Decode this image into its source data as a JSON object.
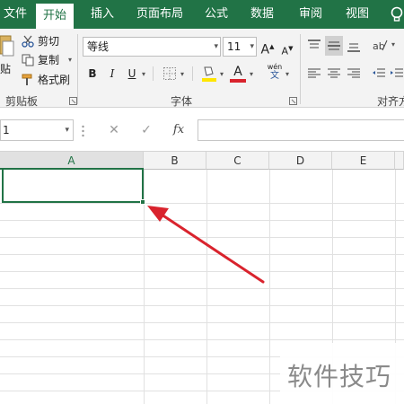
{
  "ribbon_tabs": [
    "文件",
    "开始",
    "插入",
    "页面布局",
    "公式",
    "数据",
    "审阅",
    "视图"
  ],
  "active_tab": "开始",
  "colors": {
    "excel_green": "#217346",
    "font_color_red": "#d9232d",
    "highlight_yellow": "#ffe600",
    "arrow_red": "#d9232d"
  },
  "clipboard": {
    "cut_label": "剪切",
    "copy_label": "复制",
    "format_painter_label": "格式刷",
    "paste_label_partial": "贴",
    "group_label": "剪贴板"
  },
  "font": {
    "font_name": "等线",
    "font_size": "11",
    "grow_font_glyph": "A",
    "shrink_font_glyph": "A",
    "bold_glyph": "B",
    "italic_glyph": "I",
    "underline_glyph": "U",
    "font_color_glyph": "A",
    "phonetic_label": "wén",
    "group_label": "字体"
  },
  "alignment": {
    "group_label_partial": "对齐方"
  },
  "formula_bar": {
    "name_box_value": "1",
    "cancel_glyph": "✕",
    "enter_glyph": "✓",
    "function_glyph": "fx",
    "formula_value": ""
  },
  "grid": {
    "columns": [
      "A",
      "B",
      "C",
      "D",
      "E"
    ],
    "selected_column": "A",
    "active_cell": "A1"
  },
  "annotation": {
    "type": "red-arrow",
    "points_to": "active-cell-fill-handle"
  },
  "watermark": {
    "text": "软件技巧"
  }
}
